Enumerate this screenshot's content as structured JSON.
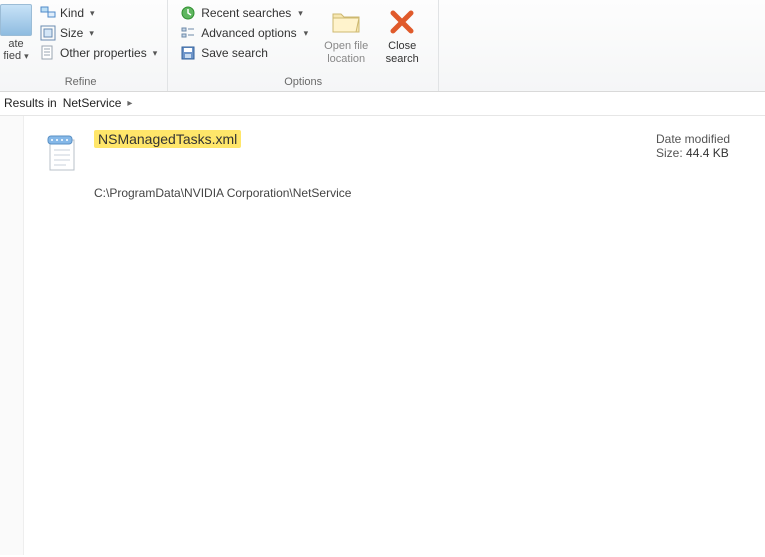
{
  "ribbon": {
    "fragment": {
      "line1": "ate",
      "line2": "fied"
    },
    "refine": {
      "label": "Refine",
      "kind": "Kind",
      "size": "Size",
      "other": "Other properties"
    },
    "options": {
      "label": "Options",
      "recent": "Recent searches",
      "advanced": "Advanced options",
      "save": "Save search",
      "open_file": "Open file",
      "open_location": "location",
      "close": "Close",
      "close_search": "search"
    }
  },
  "results_bar": {
    "prefix": "Results in",
    "scope": "NetService"
  },
  "file": {
    "name": "NSManagedTasks.xml",
    "path": "C:\\ProgramData\\NVIDIA Corporation\\NetService",
    "date_label": "Date modified",
    "size_label": "Size:",
    "size_value": "44.4 KB"
  }
}
